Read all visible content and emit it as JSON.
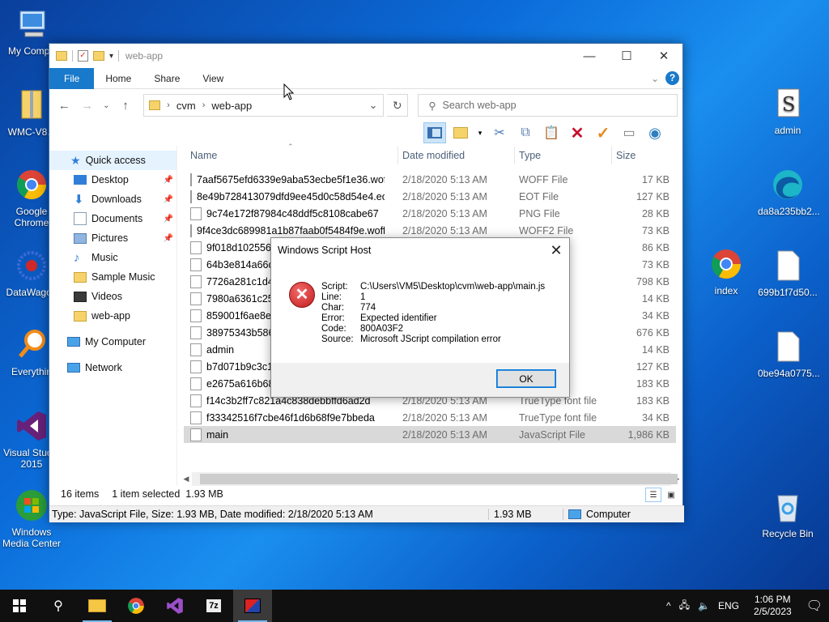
{
  "desktop": {
    "left_icons": [
      {
        "label": "My Compu",
        "icon": "my-computer-icon"
      },
      {
        "label": "WMC-V8.8",
        "icon": "zip-folder-icon"
      },
      {
        "label": "Google Chrome",
        "icon": "chrome-icon"
      },
      {
        "label": "DataWagon",
        "icon": "datawagon-icon"
      },
      {
        "label": "Everythin",
        "icon": "everything-search-icon"
      },
      {
        "label": "Visual Studio 2015",
        "icon": "visual-studio-icon"
      },
      {
        "label": "Windows Media Center",
        "icon": "media-center-icon"
      }
    ],
    "right_icons": [
      {
        "label": "admin",
        "icon": "script-file-icon"
      },
      {
        "label": "da8a235bb2...",
        "icon": "edge-icon"
      },
      {
        "label": "index",
        "icon": "chrome-icon"
      },
      {
        "label": "699b1f7d50...",
        "icon": "blank-file-icon"
      },
      {
        "label": "0be94a0775...",
        "icon": "blank-file-icon"
      },
      {
        "label": "Recycle Bin",
        "icon": "recycle-bin-icon"
      }
    ]
  },
  "explorer": {
    "title": "web-app",
    "ribbon_tabs": [
      "File",
      "Home",
      "Share",
      "View"
    ],
    "breadcrumb": [
      "cvm",
      "web-app"
    ],
    "search_placeholder": "Search web-app",
    "nav": [
      {
        "label": "Quick access",
        "icon": "star-icon"
      },
      {
        "label": "Desktop",
        "icon": "desktop-icon",
        "pinned": true
      },
      {
        "label": "Downloads",
        "icon": "downloads-icon",
        "pinned": true
      },
      {
        "label": "Documents",
        "icon": "documents-icon",
        "pinned": true
      },
      {
        "label": "Pictures",
        "icon": "pictures-icon",
        "pinned": true
      },
      {
        "label": "Music",
        "icon": "music-icon"
      },
      {
        "label": "Sample Music",
        "icon": "folder-icon"
      },
      {
        "label": "Videos",
        "icon": "videos-icon"
      },
      {
        "label": "web-app",
        "icon": "folder-icon"
      },
      {
        "label": "My Computer",
        "icon": "computer-icon"
      },
      {
        "label": "Network",
        "icon": "network-icon"
      }
    ],
    "columns": [
      "Name",
      "Date modified",
      "Type",
      "Size"
    ],
    "files": [
      {
        "name": "7aaf5675efd6339e9aba53ecbe5f1e36.woff",
        "date": "2/18/2020 5:13 AM",
        "type": "WOFF File",
        "size": "17 KB"
      },
      {
        "name": "8e49b728413079dfd9ee45d0c58d54e4.eot",
        "date": "2/18/2020 5:13 AM",
        "type": "EOT File",
        "size": "127 KB"
      },
      {
        "name": "9c74e172f87984c48ddf5c8108cabe67",
        "date": "2/18/2020 5:13 AM",
        "type": "PNG File",
        "size": "28 KB"
      },
      {
        "name": "9f4ce3dc689981a1b87faab0f5484f9e.woff2",
        "date": "2/18/2020 5:13 AM",
        "type": "WOFF2 File",
        "size": "73 KB"
      },
      {
        "name": "9f018d1025561",
        "date": "",
        "type": "",
        "size": "86 KB"
      },
      {
        "name": "64b3e814a66c2",
        "date": "",
        "type": "",
        "size": "73 KB"
      },
      {
        "name": "7726a281c1d43",
        "date": "",
        "type": "dge H...",
        "size": "798 KB"
      },
      {
        "name": "7980a6361c25b",
        "date": "",
        "type": "",
        "size": "14 KB"
      },
      {
        "name": "859001f6ae8eb",
        "date": "",
        "type": "",
        "size": "34 KB"
      },
      {
        "name": "38975343b5862",
        "date": "",
        "type": "dge H...",
        "size": "676 KB"
      },
      {
        "name": "admin",
        "date": "",
        "type": "ML Do...",
        "size": "14 KB"
      },
      {
        "name": "b7d071b9c3c19",
        "date": "",
        "type": "ont file",
        "size": "127 KB"
      },
      {
        "name": "e2675a616b68f",
        "date": "",
        "type": "",
        "size": "183 KB"
      },
      {
        "name": "f14c3b2ff7c821a4c838debbffd6ad2d",
        "date": "2/18/2020 5:13 AM",
        "type": "TrueType font file",
        "size": "183 KB"
      },
      {
        "name": "f33342516f7cbe46f1d6b68f9e7bbeda",
        "date": "2/18/2020 5:13 AM",
        "type": "TrueType font file",
        "size": "34 KB"
      },
      {
        "name": "main",
        "date": "2/18/2020 5:13 AM",
        "type": "JavaScript File",
        "size": "1,986 KB"
      }
    ],
    "status": {
      "items": "16 items",
      "selected": "1 item selected  1.93 MB"
    },
    "detail": {
      "info": "Type: JavaScript File, Size: 1.93 MB, Date modified: 2/18/2020 5:13 AM",
      "size": "1.93 MB",
      "location": "Computer"
    }
  },
  "dialog": {
    "title": "Windows Script Host",
    "fields": [
      {
        "k": "Script:",
        "v": "C:\\Users\\VM5\\Desktop\\cvm\\web-app\\main.js"
      },
      {
        "k": "Line:",
        "v": "1"
      },
      {
        "k": "Char:",
        "v": "774"
      },
      {
        "k": "Error:",
        "v": "Expected identifier"
      },
      {
        "k": "Code:",
        "v": "800A03F2"
      },
      {
        "k": "Source:",
        "v": "Microsoft JScript compilation error"
      }
    ],
    "ok_label": "OK"
  },
  "taskbar": {
    "lang": "ENG",
    "time": "1:06 PM",
    "date": "2/5/2023"
  }
}
